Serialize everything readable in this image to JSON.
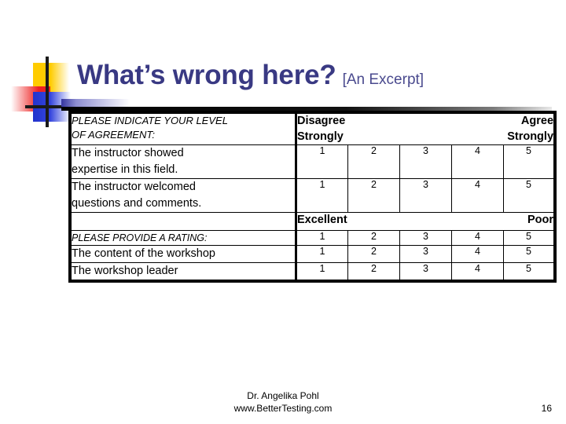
{
  "slide": {
    "title_main": "What’s wrong here?",
    "title_sub": "[An Excerpt]",
    "title_color": "#393983"
  },
  "logo": {
    "yellow": "#ffcc00",
    "red": "#ee2222",
    "blue": "#2233cc",
    "line": "#1a1a1a"
  },
  "form": {
    "header": {
      "prompt_line1": "PLEASE INDICATE YOUR LEVEL",
      "prompt_line2": "OF AGREEMENT:",
      "anchor_low_line1": "Disagree",
      "anchor_low_line2": "Strongly",
      "anchor_high_line1": "Agree",
      "anchor_high_line2": "Strongly"
    },
    "agreement_items": [
      {
        "line1": "The instructor showed",
        "line2": "expertise in this field.",
        "scale": [
          "1",
          "2",
          "3",
          "4",
          "5"
        ]
      },
      {
        "line1": "The instructor welcomed",
        "line2": "questions and comments.",
        "scale": [
          "1",
          "2",
          "3",
          "4",
          "5"
        ]
      }
    ],
    "rating_anchor": {
      "label": "",
      "anchor_high": "Excellent",
      "anchor_low": "Poor"
    },
    "rating_prompt": {
      "label": "PLEASE PROVIDE A RATING:",
      "scale": [
        "1",
        "2",
        "3",
        "4",
        "5"
      ]
    },
    "rating_items": [
      {
        "label": "The content of the workshop",
        "scale": [
          "1",
          "2",
          "3",
          "4",
          "5"
        ]
      },
      {
        "label": "The workshop leader",
        "scale": [
          "1",
          "2",
          "3",
          "4",
          "5"
        ]
      }
    ]
  },
  "footer": {
    "author": "Dr. Angelika Pohl",
    "website": "www.BetterTesting.com",
    "page_number": "16"
  }
}
